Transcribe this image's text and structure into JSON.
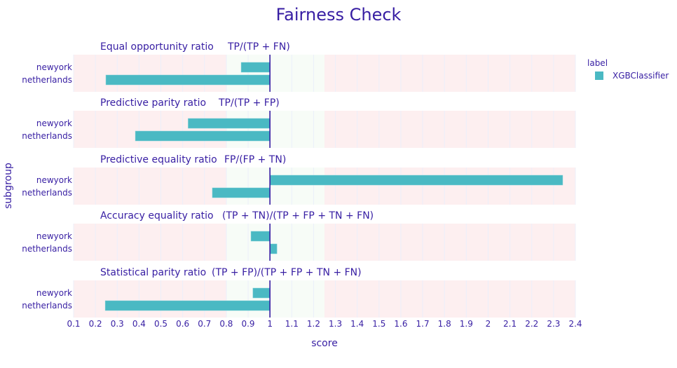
{
  "chart_data": {
    "type": "bar",
    "orientation": "horizontal",
    "title": "Fairness Check",
    "xlabel": "score",
    "ylabel": "subgroup",
    "xlim": [
      0.1,
      2.4
    ],
    "xticks": [
      "0.1",
      "0.2",
      "0.3",
      "0.4",
      "0.5",
      "0.6",
      "0.7",
      "0.8",
      "0.9",
      "1",
      "1.1",
      "1.2",
      "1.3",
      "1.4",
      "1.5",
      "1.6",
      "1.7",
      "1.8",
      "1.9",
      "2",
      "2.1",
      "2.2",
      "2.3",
      "2.4"
    ],
    "baseline": 1,
    "acceptable_range": [
      0.8,
      1.25
    ],
    "categories": [
      "newyork",
      "netherlands"
    ],
    "legend": {
      "title": "label",
      "position": "top-right",
      "entries": [
        "XGBClassifier"
      ]
    },
    "colors": {
      "bar": "#4ab9c3",
      "text": "#371ea3",
      "baseline": "#371ea3",
      "green_zone": "#f7fcf7",
      "red_zone": "#fdeff0",
      "grid": "#eceffa"
    },
    "panels": [
      {
        "metric": "Equal opportunity ratio",
        "formula": "TP/(TP + FN)",
        "series": [
          {
            "name": "XGBClassifier",
            "values": {
              "newyork": 0.868,
              "netherlands": 0.248
            }
          }
        ]
      },
      {
        "metric": "Predictive parity ratio",
        "formula": "TP/(TP + FP)",
        "series": [
          {
            "name": "XGBClassifier",
            "values": {
              "newyork": 0.625,
              "netherlands": 0.383
            }
          }
        ]
      },
      {
        "metric": "Predictive equality ratio",
        "formula": "FP/(FP + TN)",
        "series": [
          {
            "name": "XGBClassifier",
            "values": {
              "newyork": 2.342,
              "netherlands": 0.736
            }
          }
        ]
      },
      {
        "metric": "Accuracy equality ratio",
        "formula": "(TP + TN)/(TP + FP + TN + FN)",
        "series": [
          {
            "name": "XGBClassifier",
            "values": {
              "newyork": 0.913,
              "netherlands": 1.032
            }
          }
        ]
      },
      {
        "metric": "Statistical parity ratio",
        "formula": "(TP + FP)/(TP + FP + TN + FN)",
        "series": [
          {
            "name": "XGBClassifier",
            "values": {
              "newyork": 0.922,
              "netherlands": 0.245
            }
          }
        ]
      }
    ]
  }
}
